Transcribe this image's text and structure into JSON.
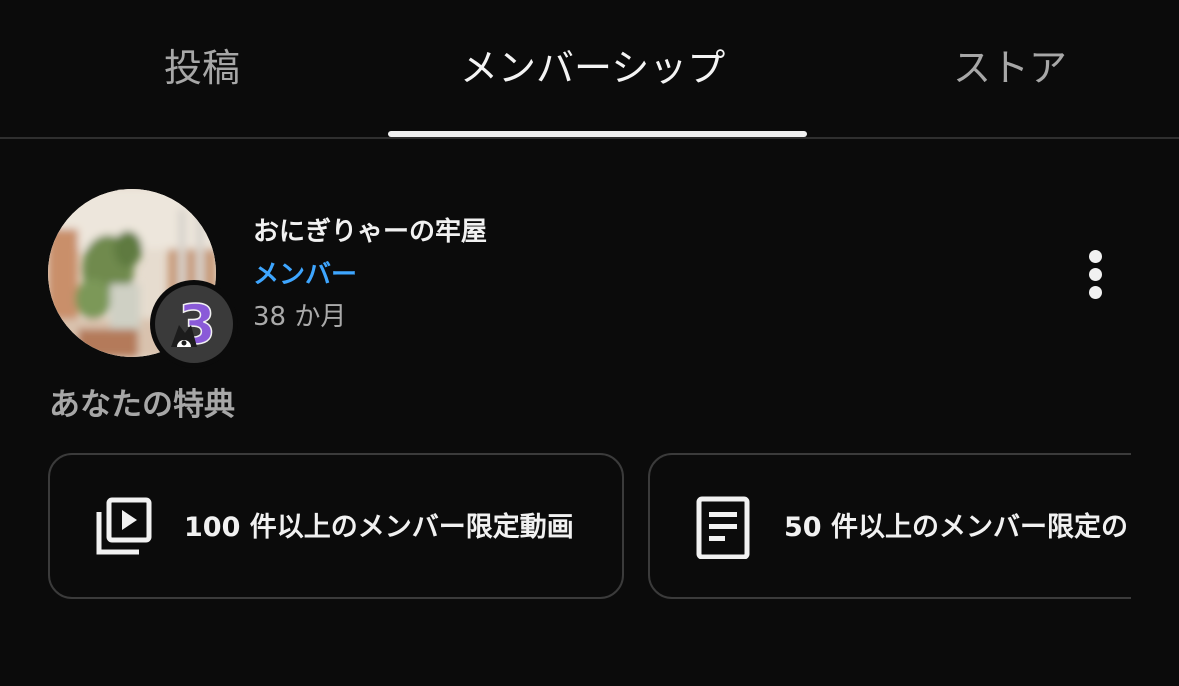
{
  "tabs": [
    {
      "label": "投稿"
    },
    {
      "label": "メンバーシップ"
    },
    {
      "label": "ストア"
    }
  ],
  "membership": {
    "channel_name": "おにぎりゃーの牢屋",
    "status": "メンバー",
    "duration": "38 か月",
    "badge_number": "3",
    "more_icon": "more-vertical-icon"
  },
  "perks": {
    "heading": "あなたの特典",
    "items": [
      {
        "label": "100 件以上のメンバー限定動画",
        "icon": "video-library-icon"
      },
      {
        "label": "50 件以上のメンバー限定の",
        "icon": "document-icon"
      }
    ]
  },
  "colors": {
    "background": "#0b0b0b",
    "accent_blue": "#3ea6ff",
    "badge_purple": "#8a5ad8"
  }
}
